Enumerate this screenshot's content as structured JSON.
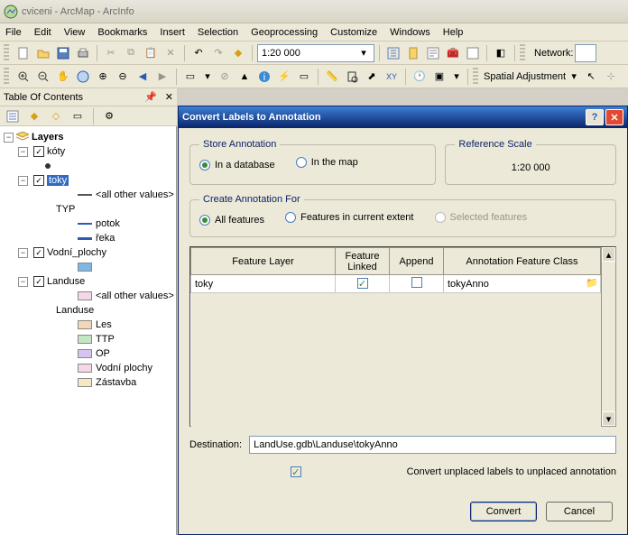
{
  "window": {
    "title": "cviceni - ArcMap - ArcInfo"
  },
  "menubar": [
    "File",
    "Edit",
    "View",
    "Bookmarks",
    "Insert",
    "Selection",
    "Geoprocessing",
    "Customize",
    "Windows",
    "Help"
  ],
  "toolbar": {
    "scale": "1:20 000",
    "network_label": "Network:",
    "spatial_adjust": "Spatial Adjustment"
  },
  "toc": {
    "title": "Table Of Contents",
    "root": "Layers",
    "nodes": {
      "koty": "kóty",
      "toky": "toky",
      "all_other": "<all other values>",
      "typ": "TYP",
      "potok": "potok",
      "reka": "řeka",
      "vodni_plochy": "Vodní_plochy",
      "landuse": "Landuse",
      "landuse_lbl": "Landuse",
      "les": "Les",
      "ttp": "TTP",
      "op": "OP",
      "vodni_plochy2": "Vodní plochy",
      "zastavba": "Zástavba"
    }
  },
  "dialog": {
    "title": "Convert Labels to Annotation",
    "store": {
      "legend": "Store Annotation",
      "in_db": "In a database",
      "in_map": "In the map"
    },
    "ref": {
      "legend": "Reference Scale",
      "value": "1:20 000"
    },
    "create": {
      "legend": "Create Annotation For",
      "all": "All features",
      "extent": "Features in current extent",
      "selected": "Selected features"
    },
    "table": {
      "headers": {
        "layer": "Feature Layer",
        "linked": "Feature Linked",
        "append": "Append",
        "afc": "Annotation Feature Class"
      },
      "row": {
        "layer": "toky",
        "afc": "tokyAnno"
      }
    },
    "dest_label": "Destination:",
    "dest_value": "LandUse.gdb\\Landuse\\tokyAnno",
    "unplaced": "Convert unplaced labels to unplaced annotation",
    "convert": "Convert",
    "cancel": "Cancel"
  }
}
